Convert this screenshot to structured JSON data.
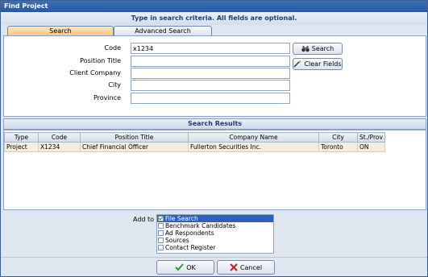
{
  "window": {
    "title": "Find Project"
  },
  "criteria_banner": "Type in search criteria. All fields are optional.",
  "tabs": [
    {
      "label": "Search",
      "active": true
    },
    {
      "label": "Advanced Search",
      "active": false
    }
  ],
  "fields": [
    {
      "label": "Code",
      "value": "x1234"
    },
    {
      "label": "Position Title",
      "value": ""
    },
    {
      "label": "Client Company",
      "value": ""
    },
    {
      "label": "City",
      "value": ""
    },
    {
      "label": "Province",
      "value": ""
    }
  ],
  "buttons": {
    "search": "Search",
    "clear": "Clear Fields",
    "ok": "OK",
    "cancel": "Cancel"
  },
  "results": {
    "title": "Search Results",
    "columns": [
      "Type",
      "Code",
      "Position Title",
      "Company Name",
      "City",
      "St./Prov"
    ],
    "rows": [
      [
        "Project",
        "X1234",
        "Chief Financial Officer",
        "Fullerton Securities Inc.",
        "Toronto",
        "ON"
      ]
    ]
  },
  "add_to": {
    "label": "Add to",
    "items": [
      {
        "label": "File Search",
        "checked": true,
        "selected": true
      },
      {
        "label": "Benchmark Candidates",
        "checked": false,
        "selected": false
      },
      {
        "label": "Ad Respondents",
        "checked": false,
        "selected": false
      },
      {
        "label": "Sources",
        "checked": false,
        "selected": false
      },
      {
        "label": "Contact Register",
        "checked": false,
        "selected": false
      }
    ]
  },
  "colors": {
    "accent": "#2a5fc4",
    "tab_active": "#f8c98a",
    "row_bg": "#f3eedd"
  }
}
